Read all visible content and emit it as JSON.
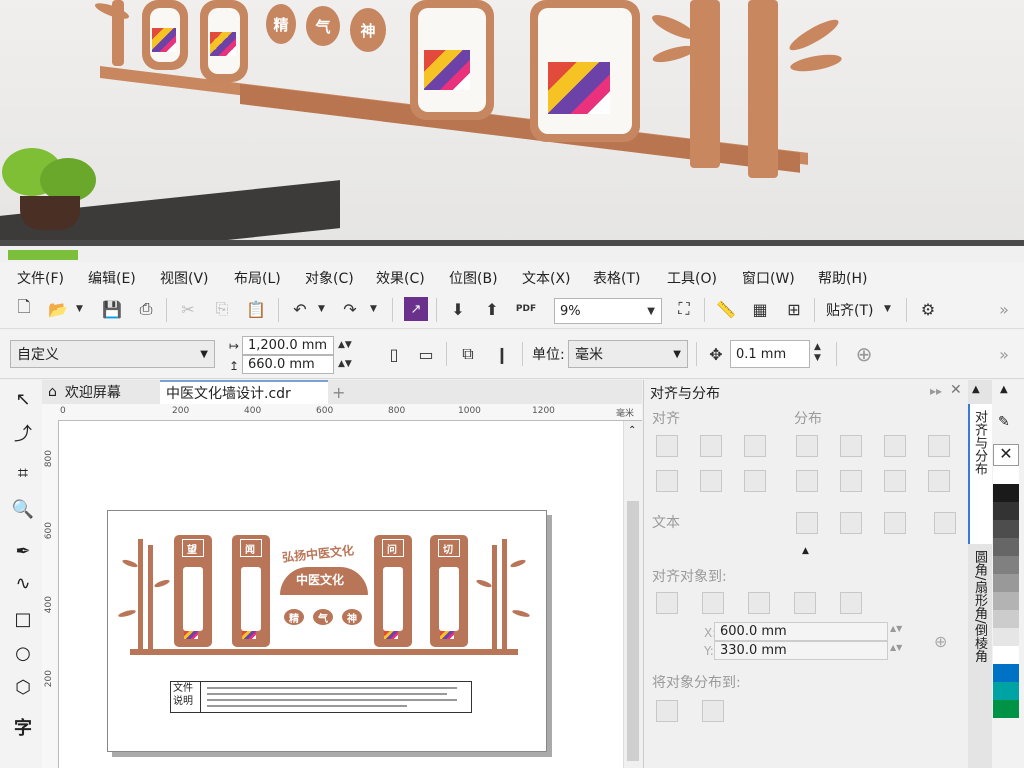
{
  "photo": {
    "pill_chars": [
      "精",
      "气",
      "神"
    ]
  },
  "menubar": {
    "items": [
      "文件(F)",
      "编辑(E)",
      "视图(V)",
      "布局(L)",
      "对象(C)",
      "效果(C)",
      "位图(B)",
      "文本(X)",
      "表格(T)",
      "工具(O)",
      "窗口(W)",
      "帮助(H)"
    ]
  },
  "toolbar": {
    "zoom_value": "9%",
    "snap_label": "贴齐(T)",
    "pdf_label": "PDF"
  },
  "property_bar": {
    "preset": "自定义",
    "width": "1,200.0 mm",
    "height": "660.0 mm",
    "unit_label": "单位:",
    "unit_value": "毫米",
    "nudge": "0.1 mm"
  },
  "tabs": {
    "welcome": "欢迎屏幕",
    "document": "中医文化墙设计.cdr",
    "add": "+"
  },
  "ruler": {
    "h_ticks": [
      "0",
      "200",
      "400",
      "600",
      "800",
      "1000",
      "1200"
    ],
    "v_ticks": [
      "800",
      "600",
      "400",
      "200"
    ],
    "unit": "毫米"
  },
  "design": {
    "banner_top": "弘扬中医文化",
    "banner_main": "中医文化",
    "pill_chars": [
      "精",
      "气",
      "神"
    ],
    "tiles": [
      "望",
      "闻",
      "问",
      "切"
    ],
    "note_label": "文件\n说明"
  },
  "docker": {
    "title": "对齐与分布",
    "align_label": "对齐",
    "distribute_label": "分布",
    "text_label": "文本",
    "align_to_label": "对齐对象到:",
    "x_value": "600.0 mm",
    "y_value": "330.0 mm",
    "x_prefix": "X:",
    "y_prefix": "Y:",
    "distribute_to_label": "将对象分布到:"
  },
  "side_tabs": [
    "对齐与分布",
    "圆角/扇形角/倒棱角"
  ],
  "palette": [
    "#ffffff",
    "#1a1a1a",
    "#333333",
    "#4d4d4d",
    "#666666",
    "#808080",
    "#999999",
    "#b3b3b3",
    "#cccccc",
    "#e6e6e6",
    "#ffffff",
    "#0072c6",
    "#00a3a3",
    "#009245"
  ]
}
